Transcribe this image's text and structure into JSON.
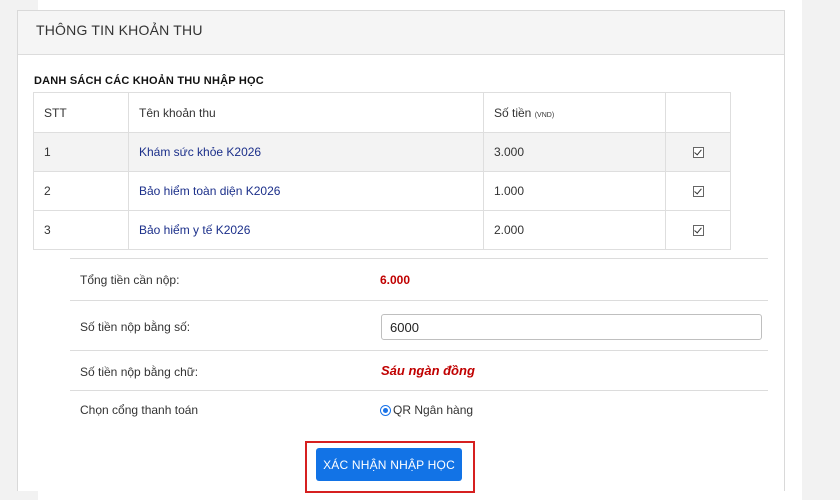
{
  "panel": {
    "title": "THÔNG TIN KHOẢN THU"
  },
  "section_title": "DANH SÁCH CÁC KHOẢN THU NHẬP HỌC",
  "table": {
    "headers": {
      "stt": "STT",
      "name": "Tên khoản thu",
      "amount": "Số tiền",
      "unit": "(VND)"
    },
    "rows": [
      {
        "stt": "1",
        "name": "Khám sức khỏe K2026",
        "amount": "3.000",
        "checked": true
      },
      {
        "stt": "2",
        "name": "Bảo hiểm toàn diện K2026",
        "amount": "1.000",
        "checked": true
      },
      {
        "stt": "3",
        "name": "Bảo hiểm y tế K2026",
        "amount": "2.000",
        "checked": true
      }
    ]
  },
  "form": {
    "total_label": "Tổng tiền cần nộp:",
    "total_value": "6.000",
    "amount_numeric_label": "Số tiền nộp bằng số:",
    "amount_numeric_value": "6000",
    "amount_words_label": "Số tiền nộp bằng chữ:",
    "amount_words_value": "Sáu ngàn đồng",
    "gateway_label": "Chọn cổng thanh toán",
    "gateway_option": "QR Ngân hàng"
  },
  "confirm_button": "XÁC NHẬN NHẬP HỌC",
  "colors": {
    "accent": "#1273e6",
    "highlight": "#d62020",
    "total": "#c00000",
    "link": "#1b2f8a"
  }
}
